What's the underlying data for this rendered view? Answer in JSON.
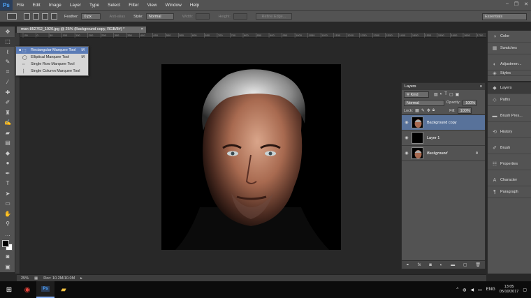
{
  "app": {
    "logo": "Ps"
  },
  "menu": [
    "File",
    "Edit",
    "Image",
    "Layer",
    "Type",
    "Select",
    "Filter",
    "View",
    "Window",
    "Help"
  ],
  "window_controls": [
    "–",
    "❐",
    "✕"
  ],
  "options": {
    "feather_label": "Feather:",
    "feather_value": "0 px",
    "antialias_label": "Anti-alias",
    "style_label": "Style:",
    "style_value": "Normal",
    "width_label": "Width:",
    "height_label": "Height:",
    "refine_edge": "Refine Edge...",
    "workspace": "Essentials"
  },
  "document": {
    "tab_title": "man-852762_1920.jpg @ 25% (Background copy, RGB/8#) *",
    "close": "×",
    "ruler_ticks": [
      "-50",
      "0",
      "50",
      "100",
      "150",
      "200",
      "250",
      "300",
      "350",
      "400",
      "450",
      "500",
      "550",
      "600",
      "650",
      "700",
      "750",
      "800",
      "850",
      "900",
      "950",
      "1000",
      "1050",
      "1100",
      "1150",
      "1200",
      "1250",
      "1300",
      "1350",
      "1400",
      "1450",
      "1500",
      "1550",
      "1600",
      "1650",
      "1700"
    ]
  },
  "status": {
    "zoom": "25%",
    "doc": "Doc: 10.2M/10.0M"
  },
  "flyout": {
    "items": [
      {
        "icon": "⬚",
        "label": "Rectangular Marquee Tool",
        "key": "M"
      },
      {
        "icon": "◯",
        "label": "Elliptical Marquee Tool",
        "key": "M"
      },
      {
        "icon": "┄",
        "label": "Single Row Marquee Tool",
        "key": ""
      },
      {
        "icon": "┆",
        "label": "Single Column Marquee Tool",
        "key": ""
      }
    ]
  },
  "layers_panel": {
    "title": "Layers",
    "kind": "Kind",
    "blend": "Normal",
    "opacity_label": "Opacity:",
    "opacity_value": "100%",
    "lock_label": "Lock:",
    "fill_label": "Fill:",
    "fill_value": "100%",
    "layers": [
      {
        "name": "Background copy",
        "selected": true
      },
      {
        "name": "Layer 1",
        "selected": false
      },
      {
        "name": "Background",
        "selected": false
      }
    ],
    "footer_icons": [
      "link-icon",
      "fx-icon",
      "mask-icon",
      "adjustment-icon",
      "folder-icon",
      "new-layer-icon",
      "trash-icon"
    ]
  },
  "dock1": [
    {
      "icon": "color-icon",
      "label": "Color"
    },
    {
      "icon": "swatches-icon",
      "label": "Swatches"
    },
    {
      "icon": "adjustments-icon",
      "label": "Adjustmen..."
    },
    {
      "icon": "styles-icon",
      "label": "Styles"
    }
  ],
  "dock2": [
    {
      "icon": "layers-icon",
      "label": "Layers"
    },
    {
      "icon": "paths-icon",
      "label": "Paths"
    },
    {
      "icon": "brush-presets-icon",
      "label": "Brush Pres..."
    },
    {
      "icon": "history-icon",
      "label": "History"
    },
    {
      "icon": "brush-icon",
      "label": "Brush"
    },
    {
      "icon": "properties-icon",
      "label": "Properties"
    },
    {
      "icon": "character-icon",
      "label": "Character"
    },
    {
      "icon": "paragraph-icon",
      "label": "Paragraph"
    }
  ],
  "taskbar": {
    "lang": "ENG",
    "time": "13:05",
    "date": "05/10/2017"
  },
  "colors": {
    "accent": "#58729a",
    "panel": "#535353",
    "canvas": "#282828"
  }
}
